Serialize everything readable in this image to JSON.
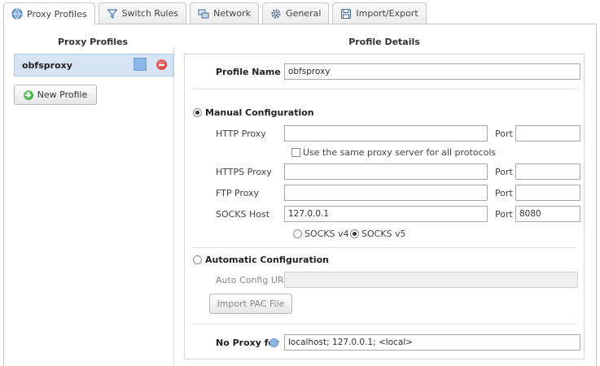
{
  "tabs": [
    {
      "label": "Proxy Profiles",
      "icon": "globe-icon",
      "active": true
    },
    {
      "label": "Switch Rules",
      "icon": "filter-icon",
      "active": false
    },
    {
      "label": "Network",
      "icon": "network-icon",
      "active": false
    },
    {
      "label": "General",
      "icon": "gear-icon",
      "active": false
    },
    {
      "label": "Import/Export",
      "icon": "floppy-icon",
      "active": false
    }
  ],
  "profiles_panel": {
    "heading": "Proxy Profiles",
    "profiles": [
      {
        "name": "obfsproxy",
        "color": "#8cb8e8"
      }
    ],
    "new_profile_label": "New Profile"
  },
  "details": {
    "heading": "Profile Details",
    "profile_name_label": "Profile Name",
    "profile_name_value": "obfsproxy",
    "manual_label": "Manual Configuration",
    "http_proxy_label": "HTTP Proxy",
    "http_proxy_value": "",
    "http_port_value": "",
    "port_label": "Port",
    "same_proxy_label": "Use the same proxy server for all protocols",
    "https_proxy_label": "HTTPS Proxy",
    "https_proxy_value": "",
    "https_port_value": "",
    "ftp_proxy_label": "FTP Proxy",
    "ftp_proxy_value": "",
    "ftp_port_value": "",
    "socks_host_label": "SOCKS Host",
    "socks_host_value": "127.0.0.1",
    "socks_port_value": "8080",
    "socks_v4_label": "SOCKS v4",
    "socks_v5_label": "SOCKS v5",
    "socks_version_selected": "SOCKS v5",
    "auto_label": "Automatic Configuration",
    "auto_url_label": "Auto Config URL",
    "auto_url_value": "",
    "import_pac_label": "Import PAC File",
    "no_proxy_label": "No Proxy for",
    "no_proxy_value": "localhost; 127.0.0.1; <local>"
  },
  "colors": {
    "selected_row": "#d6e4f5",
    "accent": "#8cb8e8"
  }
}
